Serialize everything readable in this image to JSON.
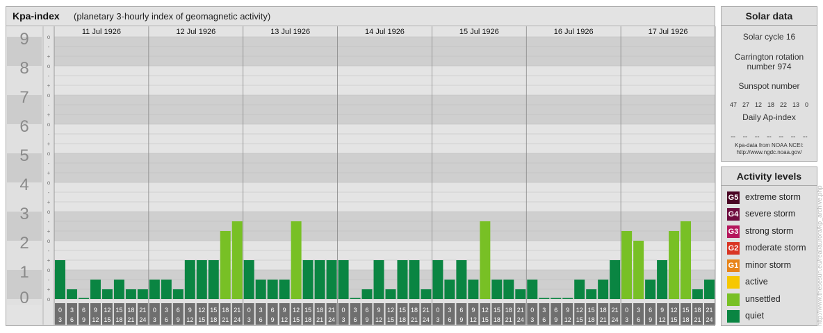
{
  "header": {
    "title": "Kpa-index",
    "subtitle": "(planetary 3-hourly index of geomagnetic activity)"
  },
  "chart_data": {
    "type": "bar",
    "y_ticks": [
      "0",
      "1",
      "2",
      "3",
      "4",
      "5",
      "6",
      "7",
      "8",
      "9"
    ],
    "ylim": [
      0,
      9
    ],
    "minor_marks": [
      "o",
      "+",
      "-",
      "o",
      "+",
      "-",
      "o",
      "+",
      "-",
      "o",
      "+",
      "-",
      "o",
      "+",
      "-",
      "o",
      "+",
      "-",
      "o",
      "+",
      "-",
      "o",
      "+",
      "-",
      "o",
      "+",
      "-",
      "o"
    ],
    "days": [
      "11 Jul 1926",
      "12 Jul 1926",
      "13 Jul 1926",
      "14 Jul 1926",
      "15 Jul 1926",
      "16 Jul 1926",
      "17 Jul 1926"
    ],
    "interval_start": [
      "0",
      "3",
      "6",
      "9",
      "12",
      "15",
      "18",
      "21"
    ],
    "interval_end": [
      "3",
      "6",
      "9",
      "12",
      "15",
      "18",
      "21",
      "24"
    ],
    "values": [
      1.333,
      0.333,
      0.0,
      0.667,
      0.333,
      0.667,
      0.333,
      0.333,
      0.667,
      0.667,
      0.333,
      1.333,
      1.333,
      1.333,
      2.333,
      2.667,
      1.333,
      0.667,
      0.667,
      0.667,
      2.667,
      1.333,
      1.333,
      1.333,
      1.333,
      0.0,
      0.333,
      1.333,
      0.333,
      1.333,
      1.333,
      0.333,
      1.333,
      0.667,
      1.333,
      0.667,
      2.667,
      0.667,
      0.667,
      0.333,
      0.667,
      0.0,
      0.0,
      0.0,
      0.667,
      0.333,
      0.667,
      1.333,
      2.333,
      2.0,
      0.667,
      1.333,
      2.333,
      2.667,
      0.333,
      0.667
    ],
    "levels": {
      "quiet_max": 1.333,
      "unsettled_max": 3.667,
      "active_max": 4.667
    },
    "colors": {
      "quiet": "#0a8542",
      "unsettled": "#78c025",
      "active": "#f6c700",
      "minor_storm": "#e88419",
      "moderate_storm": "#d93423",
      "strong_storm": "#b5165c",
      "severe_storm": "#6e0b3e",
      "extreme_storm": "#4a0424",
      "band_dark": "#cfcfcf",
      "band_light": "#e4e4e4",
      "axis_bg": "#6f6f6f"
    }
  },
  "solar_data": {
    "heading": "Solar data",
    "cycle": "Solar cycle 16",
    "carrington_line1": "Carrington rotation",
    "carrington_line2": "number 974",
    "sunspot_label": "Sunspot number",
    "sunspot_values": [
      "47",
      "27",
      "12",
      "18",
      "22",
      "13",
      "0"
    ],
    "ap_label": "Daily Ap-index",
    "ap_values": [
      "--",
      "--",
      "--",
      "--",
      "--",
      "--",
      "--"
    ],
    "source_line1": "Kpa-data from NOAA NCEI:",
    "source_line2": "http://www.ngdc.noaa.gov/"
  },
  "activity_levels": {
    "heading": "Activity levels",
    "items": [
      {
        "badge": "G5",
        "label": "extreme storm",
        "color": "#4a0424"
      },
      {
        "badge": "G4",
        "label": "severe storm",
        "color": "#6e0b3e"
      },
      {
        "badge": "G3",
        "label": "strong storm",
        "color": "#b5165c"
      },
      {
        "badge": "G2",
        "label": "moderate storm",
        "color": "#d93423"
      },
      {
        "badge": "G1",
        "label": "minor storm",
        "color": "#e88419"
      },
      {
        "badge": "",
        "label": "active",
        "color": "#f6c700"
      },
      {
        "badge": "",
        "label": "unsettled",
        "color": "#78c025"
      },
      {
        "badge": "",
        "label": "quiet",
        "color": "#0a8542"
      }
    ]
  },
  "watermark": "http://www.thesesun.eu/real/aurora/kp_archive.php"
}
